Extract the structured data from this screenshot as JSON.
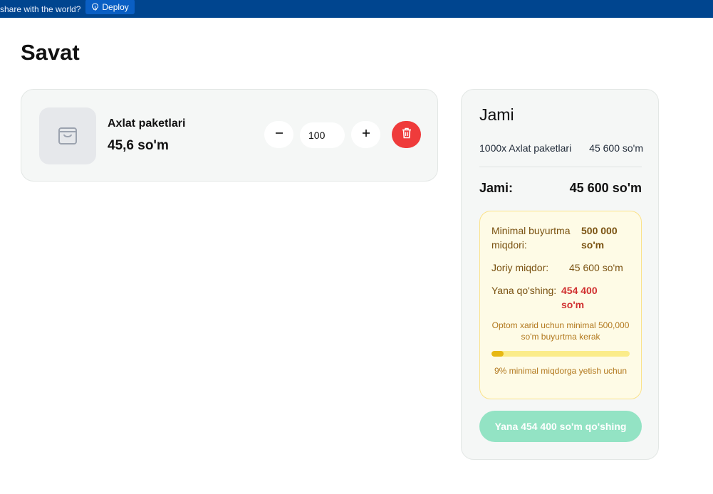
{
  "topbar": {
    "text": "share with the world?",
    "deploy_label": "Deploy"
  },
  "page": {
    "title": "Savat"
  },
  "cart": {
    "items": [
      {
        "name": "Axlat paketlari",
        "price": "45,6 so'm",
        "quantity": "100",
        "icon": "shopping-bag-icon"
      }
    ]
  },
  "summary": {
    "title": "Jami",
    "line_item_label": "1000x Axlat paketlari",
    "line_item_value": "45 600 so'm",
    "total_label": "Jami:",
    "total_value": "45 600 so'm",
    "minimum": {
      "min_label": "Minimal buyurtma miqdori:",
      "min_value": "500 000 so'm",
      "current_label": "Joriy miqdor:",
      "current_value": "45 600 so'm",
      "remaining_label": "Yana qo'shing:",
      "remaining_value": "454 400 so'm",
      "note": "Optom xarid uchun minimal 500,000 so'm buyurtma kerak",
      "progress_percent": 9,
      "progress_note": "9% minimal miqdorga yetish uchun"
    },
    "checkout_label": "Yana 454 400 so'm qo'shing"
  },
  "colors": {
    "topbar": "#00458f",
    "delete": "#ef3b3b",
    "checkout": "#93e3c4",
    "warning_bg": "#fefbe6",
    "remaining": "#d02f2f"
  }
}
